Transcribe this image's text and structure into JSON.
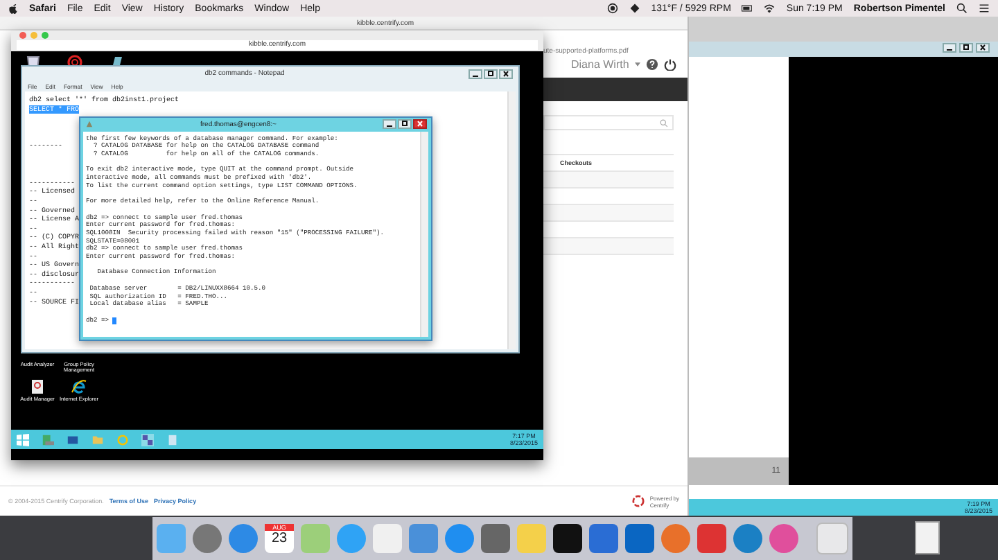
{
  "menu_bar": {
    "app": "Safari",
    "menus": [
      "File",
      "Edit",
      "View",
      "History",
      "Bookmarks",
      "Window",
      "Help"
    ],
    "sensor": "131°F / 5929 RPM",
    "clock": "Sun 7:19 PM",
    "user": "Robertson Pimentel"
  },
  "browser": {
    "address": "kibble.centrify.com",
    "pdf_tab": "ute-supported-platforms.pdf",
    "user_name": "Diana Wirth",
    "list_rows": [
      "Checkouts"
    ],
    "footer": {
      "copyright": "© 2004-2015 Centrify Corporation.",
      "links": [
        "Terms of Use",
        "Privacy Policy"
      ],
      "powered_by": "Powered by",
      "brand": "Centrify"
    }
  },
  "remote_window": {
    "page_number": "11",
    "clock": "7:19 PM",
    "date": "8/23/2015"
  },
  "inner_browser": {
    "address": "kibble.centrify.com"
  },
  "notepad": {
    "title": "db2 commands - Notepad",
    "menus": [
      "File",
      "Edit",
      "Format",
      "View",
      "Help"
    ],
    "blocks": [
      [
        {
          "text": "db2 select '*' from db2inst1.project",
          "selected": false
        },
        {
          "text": "SELECT * FRO",
          "selected": true
        }
      ],
      [
        {
          "text": "--------",
          "selected": false
        }
      ],
      [
        {
          "text": "-----------",
          "selected": false
        },
        {
          "text": "-- Licensed",
          "selected": false
        },
        {
          "text": "--",
          "selected": false
        },
        {
          "text": "-- Governed",
          "selected": false
        },
        {
          "text": "-- License A",
          "selected": false
        },
        {
          "text": "--",
          "selected": false
        },
        {
          "text": "-- (C) COPYR",
          "selected": false
        },
        {
          "text": "-- All Right",
          "selected": false
        },
        {
          "text": "--",
          "selected": false
        },
        {
          "text": "-- US Govern",
          "selected": false
        },
        {
          "text": "-- disclosur",
          "selected": false
        },
        {
          "text": "-----------",
          "selected": false
        },
        {
          "text": "--",
          "selected": false
        },
        {
          "text": "-- SOURCE FI",
          "selected": false
        }
      ]
    ]
  },
  "terminal": {
    "title": "fred.thomas@engcen8:~",
    "blocks": [
      [
        "the first few keywords of a database manager command. For example:",
        "  ? CATALOG DATABASE for help on the CATALOG DATABASE command",
        "  ? CATALOG          for help on all of the CATALOG commands."
      ],
      [
        "To exit db2 interactive mode, type QUIT at the command prompt. Outside",
        "interactive mode, all commands must be prefixed with 'db2'.",
        "To list the current command option settings, type LIST COMMAND OPTIONS."
      ],
      [
        "For more detailed help, refer to the Online Reference Manual."
      ],
      [
        "db2 => connect to sample user fred.thomas",
        "Enter current password for fred.thomas:",
        "SQL1008IN  Security processing failed with reason \"15\" (\"PROCESSING FAILURE\").",
        "SQLSTATE=08001",
        "db2 => connect to sample user fred.thomas",
        "Enter current password for fred.thomas:"
      ],
      [
        "   Database Connection Information"
      ],
      [
        " Database server        = DB2/LINUXX8664 10.5.0",
        " SQL authorization ID   = FRED.THO...",
        " Local database alias   = SAMPLE"
      ],
      [
        "db2 =>"
      ]
    ]
  },
  "desktop_icons": [
    {
      "label": "Audit Analyzer"
    },
    {
      "label": "Group Policy Management"
    },
    {
      "label": "Audit Manager"
    },
    {
      "label": "Internet Explorer"
    }
  ],
  "inner_taskbar": {
    "clock": "7:17 PM",
    "date": "8/23/2015"
  },
  "dock": {
    "calendar_month": "AUG",
    "calendar_day": "23"
  }
}
